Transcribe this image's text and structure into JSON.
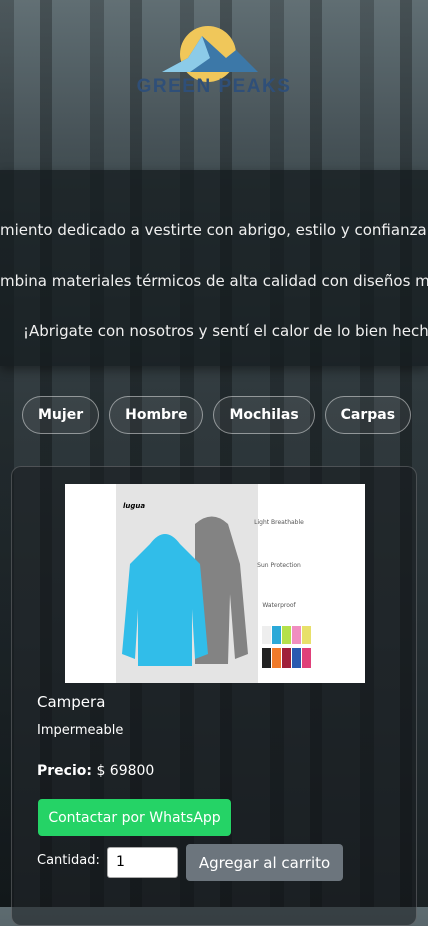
{
  "brand": {
    "name": "GREEN PEAKS",
    "colors": {
      "sun": "#f0c75a",
      "mountain": "#3c78a8",
      "text": "#2f4f78"
    }
  },
  "banner": {
    "lines": [
      "miento dedicado a vestirte con abrigo, estilo y confianza e",
      "mbina materiales térmicos de alta calidad con diseños mo",
      "¡Abrigate con nosotros y sentí el calor de lo bien hecho!"
    ]
  },
  "categories": [
    "Mujer",
    "Hombre",
    "Mochilas",
    "Carpas"
  ],
  "product": {
    "name": "Campera",
    "description": "Impermeable",
    "price_label": "Precio:",
    "price": "$ 69800",
    "image_text": {
      "brand": "lugua",
      "features": [
        "Light Breathable",
        "Sun Protection",
        "Waterproof"
      ]
    },
    "whatsapp_label": "Contactar por WhatsApp",
    "quantity_label": "Cantidad:",
    "quantity": "1",
    "add_to_cart": "Agregar al carrito"
  }
}
